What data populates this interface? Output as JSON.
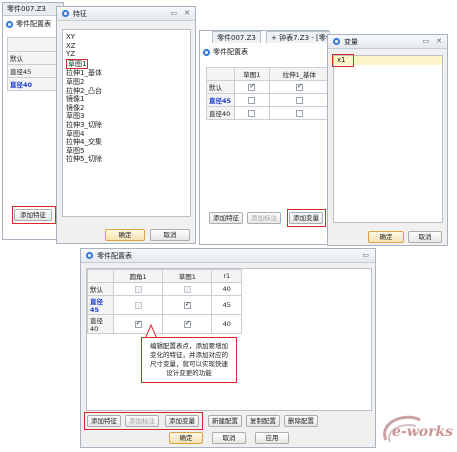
{
  "win1": {
    "title": "零件007.Z3",
    "config_title": "零件配置表",
    "rows": [
      "默认",
      "直径45",
      "直径40"
    ],
    "add_feature_btn": "添加特征"
  },
  "features": {
    "title": "特征",
    "items": [
      "XY",
      "XZ",
      "YZ",
      "草图1",
      "拉伸1_基体",
      "草图2",
      "拉伸2_凸台",
      "镜像1",
      "镜像2",
      "草图3",
      "拉伸3_切除",
      "草图4",
      "拉伸4_交集",
      "草图5",
      "拉伸5_切除"
    ],
    "ok": "确定",
    "cancel": "取消"
  },
  "win2": {
    "tab1": "零件007.Z3",
    "tab2": "+ 钟表7.Z3 - [零件",
    "config_title": "零件配置表",
    "cols": [
      "草图1",
      "拉伸1_基体"
    ],
    "rows": [
      {
        "label": "默认",
        "vals": [
          true,
          true
        ]
      },
      {
        "label": "直径45",
        "vals": [
          false,
          false
        ]
      },
      {
        "label": "直径40",
        "vals": [
          false,
          false
        ]
      }
    ],
    "add_feature_btn": "添加特征",
    "add_annotation_btn": "添加标注",
    "add_variable_btn": "添加变量"
  },
  "variables": {
    "title": "变量",
    "items": [
      "x1"
    ],
    "ok": "确定",
    "cancel": "取消"
  },
  "win3": {
    "config_title": "零件配置表",
    "cols": [
      "圆角1",
      "草图1",
      "r1"
    ],
    "rows": [
      {
        "label": "默认",
        "vals": [
          false,
          false
        ],
        "r1": "40"
      },
      {
        "label": "直径45",
        "vals": [
          false,
          true
        ],
        "r1": "45"
      },
      {
        "label": "直径40",
        "vals": [
          true,
          true
        ],
        "r1": "40"
      }
    ],
    "callout": "编辑配置表点，添加要增加变化的特征，并添加对应的尺寸变量，就可以实现快速设计变更的功能",
    "buttons": {
      "add_feature": "添加特征",
      "add_annotation": "添加标注",
      "add_variable": "添加变量",
      "new_config": "新建配置",
      "copy_config": "复制配置",
      "delete_config": "删除配置",
      "ok": "确定",
      "cancel": "取消",
      "apply": "应用"
    }
  },
  "watermark": "e-works"
}
